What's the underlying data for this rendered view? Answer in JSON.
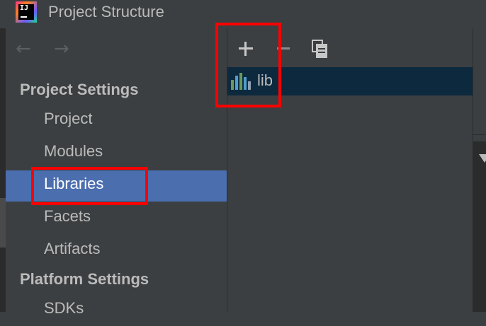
{
  "window": {
    "title": "Project Structure",
    "logo_text": "IJ"
  },
  "nav": {
    "back_icon": "arrow-left-icon",
    "forward_icon": "arrow-right-icon",
    "back_glyph": "←",
    "forward_glyph": "→"
  },
  "sidebar": {
    "project_settings_header": "Project Settings",
    "project_items": [
      {
        "label": "Project"
      },
      {
        "label": "Modules"
      },
      {
        "label": "Libraries",
        "selected": true
      },
      {
        "label": "Facets"
      },
      {
        "label": "Artifacts"
      }
    ],
    "platform_settings_header": "Platform Settings",
    "platform_items": [
      {
        "label": "SDKs"
      }
    ]
  },
  "toolbar": {
    "add_icon": "plus-icon",
    "remove_icon": "minus-icon",
    "copy_icon": "copy-icon"
  },
  "libraries": {
    "items": [
      {
        "name": "lib",
        "icon": "library-icon"
      }
    ]
  },
  "colors": {
    "background": "#3c3f41",
    "selection": "#4b6eaf",
    "list_selection": "#0d293e",
    "highlight": "#ff0000",
    "text": "#bbbbbb"
  }
}
